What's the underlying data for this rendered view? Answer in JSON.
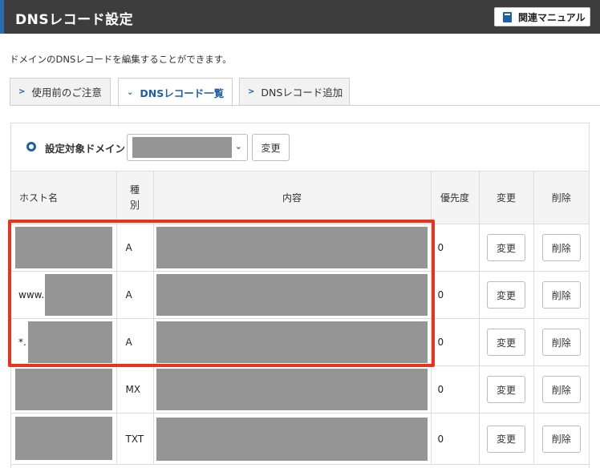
{
  "header": {
    "title": "DNSレコード設定",
    "manual_label": "関連マニュアル"
  },
  "description": "ドメインのDNSレコードを編集することができます。",
  "tabs": [
    {
      "label": "使用前のご注意",
      "active": false
    },
    {
      "label": "DNSレコード一覧",
      "active": true
    },
    {
      "label": "DNSレコード追加",
      "active": false
    }
  ],
  "domain_selector": {
    "label": "設定対象ドメイン",
    "value": "",
    "change_label": "変更"
  },
  "table": {
    "headers": {
      "host": "ホスト名",
      "type": "種別",
      "content": "内容",
      "priority": "優先度",
      "edit": "変更",
      "delete": "削除"
    },
    "rows": [
      {
        "host_prefix": "",
        "type": "A",
        "priority": "0",
        "edit_label": "変更",
        "delete_label": "削除",
        "highlighted": true
      },
      {
        "host_prefix": "www.",
        "type": "A",
        "priority": "0",
        "edit_label": "変更",
        "delete_label": "削除",
        "highlighted": true
      },
      {
        "host_prefix": "*.",
        "type": "A",
        "priority": "0",
        "edit_label": "変更",
        "delete_label": "削除",
        "highlighted": true
      },
      {
        "host_prefix": "",
        "type": "MX",
        "priority": "0",
        "edit_label": "変更",
        "delete_label": "削除",
        "highlighted": false
      },
      {
        "host_prefix": "",
        "type": "TXT",
        "priority": "0",
        "edit_label": "変更",
        "delete_label": "削除",
        "highlighted": false
      }
    ]
  },
  "colors": {
    "header_bg": "#3d3d3d",
    "accent": "#1f5fa8",
    "highlight": "#e8341c",
    "redaction": "#959595"
  }
}
